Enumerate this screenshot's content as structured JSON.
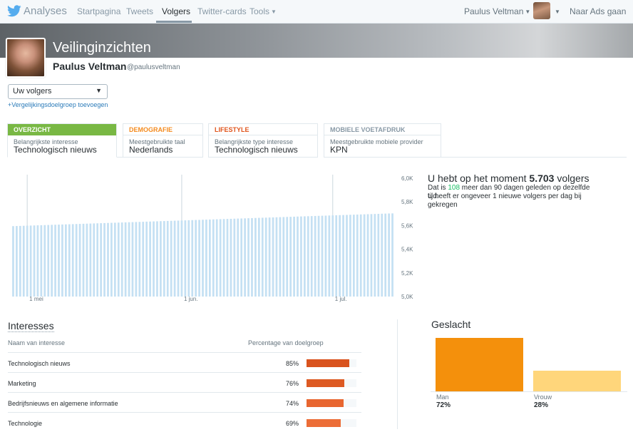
{
  "topbar": {
    "app_name": "Analyses",
    "nav": [
      "Startpagina",
      "Tweets",
      "Volgers",
      "Twitter-cards",
      "Tools"
    ],
    "user_menu": "Paulus Veltman",
    "ads_link": "Naar Ads gaan"
  },
  "header": {
    "title": "Veilinginzichten",
    "name": "Paulus Veltman",
    "handle": "@paulusveltman"
  },
  "audience_select": {
    "value": "Uw volgers"
  },
  "add_comparison": "+Vergelijkingsdoelgroep toevoegen",
  "tabs": [
    {
      "head": "OVERZICHT",
      "sub": "Belangrijkste interesse",
      "value": "Technologisch nieuws",
      "color": "#79b844"
    },
    {
      "head": "DEMOGRAFIE",
      "sub": "Meestgebruikte taal",
      "value": "Nederlands",
      "color": "#f48b1f"
    },
    {
      "head": "LIFESTYLE",
      "sub": "Belangrijkste type interesse",
      "value": "Technologisch nieuws",
      "color": "#e0541c"
    },
    {
      "head": "MOBIELE VOETAFDRUK",
      "sub": "Meestgebruikte mobiele provider",
      "value": "KPN",
      "color": "#8899a6"
    }
  ],
  "stats": {
    "title_prefix": "U hebt op het moment ",
    "followers": "5.703",
    "title_suffix": " volgers",
    "line1_a": "Dat is ",
    "line1_num": "108",
    "line1_b": " meer dan 90 dagen geleden op dezelfde tijd.",
    "line2": "U heeft er ongeveer 1 nieuwe volgers per dag bij gekregen"
  },
  "chart_data": {
    "type": "bar",
    "title": "",
    "xlabel": "",
    "ylabel": "",
    "ylim": [
      5000,
      6000
    ],
    "y_ticks": [
      "6,0K",
      "5,8K",
      "5,6K",
      "5,4K",
      "5,2K",
      "5,0K"
    ],
    "x_tick_labels": [
      "1 mei",
      "1 jun.",
      "1 jul."
    ],
    "x_tick_indices": [
      4,
      48,
      91
    ],
    "bar_color": "#c4e0f3",
    "values": [
      5595,
      5596,
      5597,
      5598,
      5599,
      5600,
      5601,
      5602,
      5603,
      5604,
      5605,
      5606,
      5607,
      5608,
      5609,
      5610,
      5611,
      5612,
      5613,
      5614,
      5615,
      5616,
      5617,
      5618,
      5619,
      5620,
      5621,
      5622,
      5623,
      5624,
      5625,
      5626,
      5627,
      5628,
      5629,
      5630,
      5631,
      5632,
      5633,
      5634,
      5635,
      5636,
      5637,
      5638,
      5639,
      5640,
      5641,
      5642,
      5643,
      5644,
      5645,
      5646,
      5647,
      5648,
      5649,
      5650,
      5651,
      5652,
      5653,
      5654,
      5655,
      5656,
      5657,
      5658,
      5659,
      5660,
      5661,
      5662,
      5663,
      5664,
      5665,
      5666,
      5667,
      5668,
      5669,
      5670,
      5671,
      5672,
      5673,
      5674,
      5675,
      5676,
      5677,
      5678,
      5679,
      5680,
      5681,
      5682,
      5683,
      5684,
      5685,
      5686,
      5687,
      5688,
      5689,
      5690,
      5691,
      5692,
      5693,
      5694,
      5695,
      5696,
      5697,
      5698,
      5699,
      5700,
      5701,
      5702,
      5703
    ]
  },
  "interests": {
    "title": "Interesses",
    "col_name": "Naam van interesse",
    "col_pct": "Percentage van doelgroep",
    "rows": [
      {
        "name": "Technologisch nieuws",
        "pct": "85%",
        "value": 85,
        "color": "#d9531e"
      },
      {
        "name": "Marketing",
        "pct": "76%",
        "value": 76,
        "color": "#dd5a23"
      },
      {
        "name": "Bedrijfsnieuws  en algemene informatie",
        "pct": "74%",
        "value": 74,
        "color": "#e86630"
      },
      {
        "name": "Technologie",
        "pct": "69%",
        "value": 69,
        "color": "#ec6d37"
      }
    ]
  },
  "gender": {
    "title": "Geslacht",
    "items": [
      {
        "label": "Man",
        "pct": "72%",
        "value": 72,
        "color": "#f4900c"
      },
      {
        "label": "Vrouw",
        "pct": "28%",
        "value": 28,
        "color": "#ffd67b"
      }
    ]
  }
}
